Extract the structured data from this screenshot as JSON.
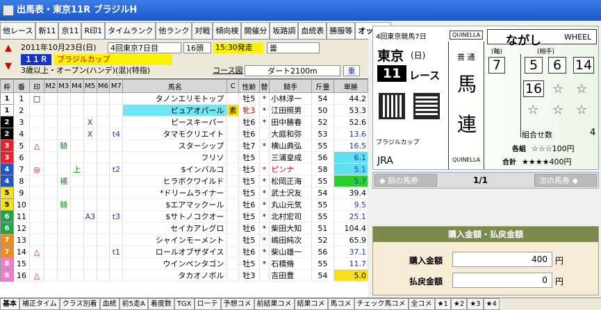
{
  "window": {
    "title": "出馬表・東京11R ブラジルH"
  },
  "tabs": [
    "他レース",
    "新11",
    "京11",
    "R印1",
    "タイムランク",
    "他ランク",
    "対戦",
    "傾向検",
    "開催分",
    "坂路調",
    "血統表",
    "勝服等",
    "オッズ取"
  ],
  "race": {
    "date": "2011年10月23日(日)",
    "meeting": "4回東京7日目",
    "headcount": "16頭",
    "post_time": "15:30発走",
    "weather": "曇",
    "race_no": "１１Ｒ",
    "name": "ブラジルカップ",
    "conditions": "3歳以上・オープン(ハンデ)(混)(特指)",
    "course_label": "コース図",
    "course": "ダート2100m",
    "going": "重"
  },
  "columns": [
    "枠",
    "番",
    "印",
    "M2",
    "M3",
    "M4",
    "M5",
    "M6",
    "M7",
    "馬名",
    "C",
    "性齢",
    "替",
    "騎手",
    "斤量",
    "単勝"
  ],
  "runners": [
    {
      "waku": "1",
      "num": "1",
      "mark": "□",
      "m3": "",
      "m4": "",
      "m5": "",
      "m6": "",
      "m7": "",
      "name": "タノンエリモトップ",
      "c": "",
      "sexage": "牡5",
      "kae": "*",
      "jockey": "小林淳一",
      "kin": "54",
      "odds": "44.2"
    },
    {
      "waku": "1",
      "num": "2",
      "mark": "",
      "m3": "",
      "m4": "",
      "m5": "",
      "m6": "",
      "m7": "",
      "name": "ピュアオパール",
      "c": "素",
      "sexage": "牝3",
      "kae": "*",
      "jockey": "江田照男",
      "kin": "50",
      "odds": "53.3"
    },
    {
      "waku": "2",
      "num": "3",
      "mark": "",
      "m3": "",
      "m4": "",
      "m5": "X",
      "m6": "",
      "m7": "",
      "name": "ピースキーパー",
      "c": "",
      "sexage": "牡6",
      "kae": "*",
      "jockey": "田中勝春",
      "kin": "52",
      "odds": "52.6"
    },
    {
      "waku": "2",
      "num": "4",
      "mark": "",
      "m3": "",
      "m4": "",
      "m5": "X",
      "m6": "",
      "m7": "t4",
      "name": "タマモクリエイト",
      "c": "",
      "sexage": "牡6",
      "kae": "",
      "jockey": "大庭和弥",
      "kin": "53",
      "odds": "13.6"
    },
    {
      "waku": "3",
      "num": "5",
      "mark": "△",
      "m3": "騎",
      "m4": "",
      "m5": "",
      "m6": "",
      "m7": "",
      "name": "スターシップ",
      "c": "",
      "sexage": "牡7",
      "kae": "*",
      "jockey": "横山典弘",
      "kin": "55",
      "odds": "16.5"
    },
    {
      "waku": "3",
      "num": "6",
      "mark": "",
      "m3": "",
      "m4": "",
      "m5": "",
      "m6": "",
      "m7": "",
      "name": "フリソ",
      "c": "",
      "sexage": "牡5",
      "kae": "",
      "jockey": "三浦皇成",
      "kin": "56",
      "odds": "6.1"
    },
    {
      "waku": "4",
      "num": "7",
      "mark": "◎",
      "m3": "",
      "m4": "上",
      "m5": "",
      "m6": "",
      "m7": "t2",
      "name": "$インバルコ",
      "c": "",
      "sexage": "牡5",
      "kae": "*",
      "jockey": "ピンナ",
      "kin": "58",
      "odds": "5.1"
    },
    {
      "waku": "4",
      "num": "8",
      "mark": "",
      "m3": "補",
      "m4": "",
      "m5": "",
      "m6": "",
      "m7": "",
      "name": "ヒラボクワイルド",
      "c": "",
      "sexage": "牡5",
      "kae": "*",
      "jockey": "松岡正海",
      "kin": "55",
      "odds": "5.7"
    },
    {
      "waku": "5",
      "num": "9",
      "mark": "",
      "m3": "",
      "m4": "",
      "m5": "",
      "m6": "",
      "m7": "",
      "name": "*ドリームライナー",
      "c": "",
      "sexage": "牡5",
      "kae": "*",
      "jockey": "武士沢友",
      "kin": "54",
      "odds": "39.4"
    },
    {
      "waku": "5",
      "num": "10",
      "mark": "",
      "m3": "騎",
      "m4": "",
      "m5": "",
      "m6": "",
      "m7": "",
      "name": "$エアマックール",
      "c": "",
      "sexage": "牡6",
      "kae": "*",
      "jockey": "丸山元気",
      "kin": "55",
      "odds": "9.5"
    },
    {
      "waku": "6",
      "num": "11",
      "mark": "",
      "m3": "",
      "m4": "",
      "m5": "A3",
      "m6": "",
      "m7": "t3",
      "name": "$サトノコクオー",
      "c": "",
      "sexage": "牡5",
      "kae": "*",
      "jockey": "北村宏司",
      "kin": "55",
      "odds": "25.1"
    },
    {
      "waku": "6",
      "num": "12",
      "mark": "",
      "m3": "",
      "m4": "",
      "m5": "",
      "m6": "",
      "m7": "",
      "name": "セイカアレグロ",
      "c": "",
      "sexage": "牡6",
      "kae": "*",
      "jockey": "柴田大知",
      "kin": "51",
      "odds": "104.4"
    },
    {
      "waku": "7",
      "num": "13",
      "mark": "",
      "m3": "",
      "m4": "",
      "m5": "",
      "m6": "",
      "m7": "",
      "name": "シャインモーメント",
      "c": "",
      "sexage": "牡5",
      "kae": "*",
      "jockey": "嶋田純次",
      "kin": "52",
      "odds": "65.9"
    },
    {
      "waku": "7",
      "num": "14",
      "mark": "△",
      "m3": "",
      "m4": "",
      "m5": "",
      "m6": "",
      "m7": "t1",
      "name": "ロールオブザダイス",
      "c": "",
      "sexage": "牡6",
      "kae": "*",
      "jockey": "柴山雄一",
      "kin": "56",
      "odds": "37.1"
    },
    {
      "waku": "8",
      "num": "15",
      "mark": "",
      "m3": "",
      "m4": "",
      "m5": "",
      "m6": "",
      "m7": "",
      "name": "ウインペンタゴン",
      "c": "",
      "sexage": "牡5",
      "kae": "*",
      "jockey": "石橋脩",
      "kin": "55",
      "odds": "11.7"
    },
    {
      "waku": "8",
      "num": "16",
      "mark": "△",
      "m3": "",
      "m4": "",
      "m5": "",
      "m6": "",
      "m7": "",
      "name": "タカオノボル",
      "c": "",
      "sexage": "牡3",
      "kae": "",
      "jockey": "吉田豊",
      "kin": "54",
      "odds": "5.0"
    }
  ],
  "ticket": {
    "header_small": "4回東京競馬7日",
    "quinella_top": "QUINELLA",
    "bet_type": "ながし",
    "bet_type_en": "WHEEL",
    "venue": "東京",
    "day": "(日)",
    "race": "11",
    "race_suffix": "レース",
    "kind_small": "普 通",
    "kind_big1": "馬",
    "kind_big2": "連",
    "quinella_bottom": "QUINELLA",
    "axis_label": "(軸)",
    "partner_label": "(相手)",
    "axis_horse": "7",
    "partners": [
      "5",
      "6",
      "14",
      "16"
    ],
    "star": "☆",
    "race_name_small": "ブラジルカップ",
    "jra": "JRA",
    "combo_label": "組合せ数",
    "combo_count": "4",
    "each_label": "各組",
    "each_value": "☆☆☆100円",
    "total_label": "合計",
    "total_value": "★★★★400円"
  },
  "nav": {
    "prev": "前の馬券",
    "page": "1/1",
    "next": "次の馬券"
  },
  "payment": {
    "header": "購入金額・払戻金額",
    "purchase_label": "購入金額",
    "purchase_value": "400",
    "payout_label": "払戻金額",
    "payout_value": "0",
    "unit": "円"
  },
  "bottom_tabs": [
    "基本",
    "補正タイム",
    "クラス別着",
    "血統",
    "前5走A",
    "着度数",
    "TGX",
    "ローテ",
    "予想コメ",
    "前結果コメ",
    "結果コメ",
    "馬コメ",
    "チェック馬コメ",
    "全コメ",
    "★1",
    "★2",
    "★3",
    "★4"
  ],
  "colors": {
    "waku1": "#ffffff",
    "waku2": "#000000",
    "waku3": "#e8242b",
    "waku4": "#1f56c9",
    "waku5": "#f5e11a",
    "waku6": "#24a34a",
    "waku7": "#f08c1e",
    "waku8": "#f07bd0"
  }
}
